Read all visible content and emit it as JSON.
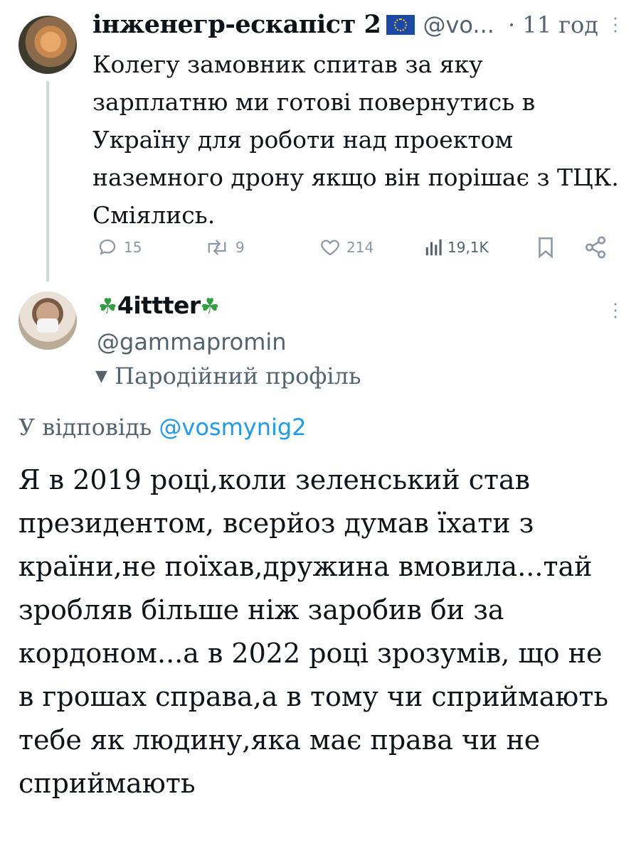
{
  "tweet1": {
    "display_name": "інженегр-ескапіст 2",
    "handle": "@vo...",
    "time": "· 11 год",
    "text": "Колегу замовник спитав за яку зарплатню ми готові повернутись в Україну для роботи над проектом наземного дрону якщо він порішає з ТЦК. Сміялись.",
    "stats": {
      "replies": "15",
      "reposts": "9",
      "likes": "214",
      "views": "19,1K"
    }
  },
  "tweet2": {
    "display_name": "4ittter",
    "handle": "@gammapromin",
    "parody_label": "Пародійний профіль",
    "reply_prefix": "У відповідь",
    "reply_to": "@vosmynig2",
    "text": "Я в 2019 році,коли зеленський став президентом, всерйоз думав їхати з країни,не поїхав,дружина вмовила...тай зробляв більше ніж заробив би за кордоном...а в 2022 році зрозумів, що не в грошах справа,а в тому чи сприймають тебе як людину,яка має права чи не сприймають"
  },
  "colors": {
    "link": "#1d9bf0",
    "muted": "#536471",
    "icon": "#8b98a5"
  },
  "icons": [
    "reply-icon",
    "repost-icon",
    "like-icon",
    "views-icon",
    "bookmark-icon",
    "share-icon",
    "more-icon",
    "clover-icon",
    "eu-flag-icon",
    "parody-mask-icon"
  ]
}
